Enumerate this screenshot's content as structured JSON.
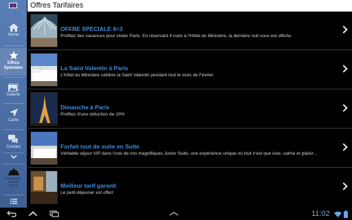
{
  "header": {
    "title": "Offres Tarifaires"
  },
  "sidebar": {
    "language_flag": "uk-flag-icon",
    "items": [
      {
        "label": "Home",
        "icon": "home-icon"
      },
      {
        "label": "Offres Spéciales",
        "icon": "star-icon",
        "active": true
      },
      {
        "label": "Galerie",
        "icon": "gallery-icon"
      },
      {
        "label": "Carte",
        "icon": "navigation-arrow-icon"
      },
      {
        "label": "Contact",
        "icon": "chat-bubbles-icon"
      },
      {
        "label": "Réservation Rapide 0.00 €",
        "icon": "hotel-bell-icon"
      }
    ],
    "more_icon": "chevron-down-icon",
    "menu_icon": "list-menu-icon",
    "booking_text_1": "Réservation",
    "booking_text_2": "Rapide",
    "booking_text_3": "0.00 €"
  },
  "offers": [
    {
      "title": "OFFRE SPECIALE 4=3",
      "description": "Profitez des vacances pour visiter Paris. En réservant 4 nuits à l'Hôtel du Ministère, la dernière nuit vous est offerte.",
      "image": "hotel-lobby-glass-roof"
    },
    {
      "title": "La Saint Valentin à Paris",
      "description": "L'hôtel du Ministère célèbre la Saint Valentin pendant tout le mois de Février.",
      "image": "hotel-bedroom"
    },
    {
      "title": "Dimanche à Paris",
      "description": "Profitez d'une réduction de 10%",
      "image": "eiffel-tower-night"
    },
    {
      "title": "Forfait tout de suite en Suite",
      "description": "Véritable séjour VIP dans l'une de nos magnifiques Junior Suite, une expérience unique où tout n'est que luxe, calme et plaisir...",
      "image": "junior-suite"
    },
    {
      "title": "Meilleur tarif garanti",
      "description": "Le petit-déjeuner est offert",
      "image": "breakfast-room"
    }
  ],
  "system": {
    "time": "11:02",
    "accent": "#3d8fe0"
  }
}
